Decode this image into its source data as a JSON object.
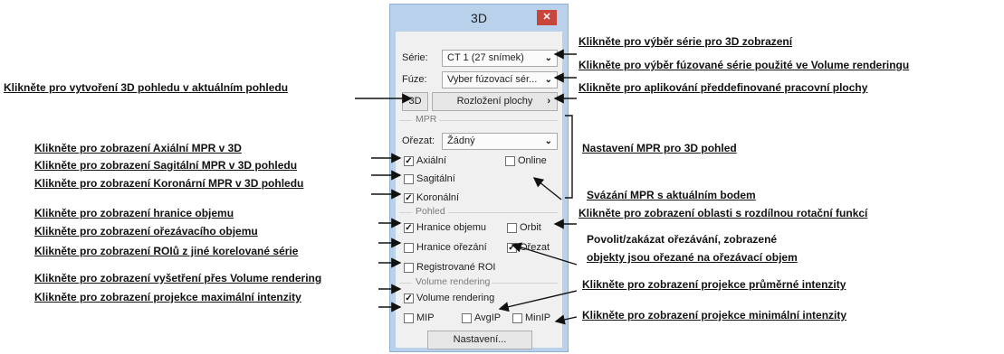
{
  "window": {
    "title": "3D",
    "close_glyph": "✕"
  },
  "series": {
    "label": "Série:",
    "value": "CT 1 (27 snímek)"
  },
  "fusion": {
    "label": "Fúze:",
    "value": "Vyber fúzovací sér..."
  },
  "buttons": {
    "view3d": "3D",
    "layout": "Rozložení plochy",
    "layout_arrow": "›",
    "settings": "Nastavení..."
  },
  "mpr": {
    "group": "MPR",
    "crop_label": "Ořezat:",
    "crop_value": "Žádný",
    "axial": {
      "label": "Axiální",
      "checked": true
    },
    "online": {
      "label": "Online",
      "checked": false
    },
    "sagittal": {
      "label": "Sagitální",
      "checked": false
    },
    "coronal": {
      "label": "Koronální",
      "checked": true
    }
  },
  "view": {
    "group": "Pohled",
    "bounds": {
      "label": "Hranice objemu",
      "checked": true
    },
    "orbit": {
      "label": "Orbit",
      "checked": false
    },
    "crop_bounds": {
      "label": "Hranice ořezání",
      "checked": false
    },
    "crop": {
      "label": "Ořezat",
      "checked": true
    },
    "reg_roi": {
      "label": "Registrované ROI",
      "checked": false
    }
  },
  "vr": {
    "group": "Volume rendering",
    "volume": {
      "label": "Volume rendering",
      "checked": true
    },
    "mip": {
      "label": "MIP",
      "checked": false
    },
    "avgip": {
      "label": "AvgIP",
      "checked": false
    },
    "minip": {
      "label": "MinIP",
      "checked": false
    }
  },
  "annotations": {
    "series_select": "Klikněte pro výběr série pro 3D zobrazení",
    "fusion_select": "Klikněte pro výběr fúzované série použité ve Volume renderingu",
    "create_3d": "Klikněte pro vytvoření 3D pohledu v aktuálním pohledu",
    "apply_workspace": "Klikněte pro aplikování předdefinované pracovní plochy",
    "axial_mpr": "Klikněte pro zobrazení Axiální MPR v 3D",
    "mpr_settings": "Nastavení MPR pro 3D pohled",
    "sagittal_mpr": "Klikněte pro zobrazení Sagitální MPR v 3D pohledu",
    "coronal_mpr": "Klikněte pro zobrazení Koronární MPR v 3D pohledu",
    "link_mpr": "Svázání MPR s aktuálním bodem",
    "volume_bounds": "Klikněte pro zobrazení  hranice objemu",
    "orbit_area": "Klikněte pro zobrazení oblasti s rozdílnou rotační funkcí",
    "crop_volume": "Klikněte pro zobrazení ořezávacího objemu",
    "crop_toggle_1": "Povolit/zakázat   ořezávání,   zobrazené",
    "roi_other": "Klikněte pro zobrazení ROIů z jiné korelované série",
    "crop_toggle_2": "objekty jsou ořezané na ořezávací objem",
    "vr_exam": "Klikněte pro zobrazení vyšetření přes Volume rendering",
    "avg_proj": "Klikněte pro zobrazení projekce průměrné intenzity",
    "max_proj": "Klikněte pro zobrazení projekce maximální intenzity",
    "min_proj": "Klikněte pro zobrazení projekce minimální intenzity"
  },
  "colors": {
    "window_frame": "#b9d1ea",
    "close_button": "#c7453a",
    "client_bg": "#f0f0f0"
  }
}
